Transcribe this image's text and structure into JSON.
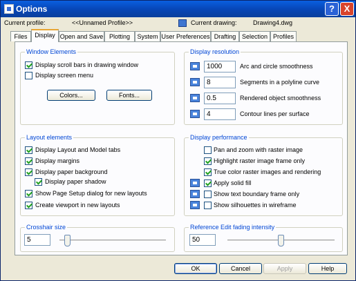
{
  "window": {
    "title": "Options"
  },
  "titlebar_buttons": {
    "help": "?",
    "close": "X"
  },
  "profile": {
    "current_profile_label": "Current profile:",
    "current_profile_value": "<<Unnamed Profile>>",
    "current_drawing_label": "Current drawing:",
    "current_drawing_value": "Drawing4.dwg"
  },
  "tabs": [
    "Files",
    "Display",
    "Open and Save",
    "Plotting",
    "System",
    "User Preferences",
    "Drafting",
    "Selection",
    "Profiles"
  ],
  "active_tab": "Display",
  "window_elements": {
    "title": "Window Elements",
    "scroll_bars": {
      "label": "Display scroll bars in drawing window",
      "checked": true
    },
    "screen_menu": {
      "label": "Display screen menu",
      "checked": false
    },
    "colors_button": "Colors...",
    "fonts_button": "Fonts..."
  },
  "display_resolution": {
    "title": "Display resolution",
    "rows": [
      {
        "value": "1000",
        "label": "Arc and circle smoothness"
      },
      {
        "value": "8",
        "label": "Segments in a polyline curve"
      },
      {
        "value": "0.5",
        "label": "Rendered object smoothness"
      },
      {
        "value": "4",
        "label": "Contour lines per surface"
      }
    ]
  },
  "layout_elements": {
    "title": "Layout elements",
    "items": [
      {
        "label": "Display Layout and Model tabs",
        "checked": true
      },
      {
        "label": "Display margins",
        "checked": true
      },
      {
        "label": "Display paper background",
        "checked": true
      },
      {
        "label": "Display paper shadow",
        "checked": true
      },
      {
        "label": "Show Page Setup dialog for new layouts",
        "checked": true
      },
      {
        "label": "Create viewport in new layouts",
        "checked": true
      }
    ]
  },
  "display_performance": {
    "title": "Display performance",
    "items": [
      {
        "label": "Pan and zoom with raster image",
        "checked": false
      },
      {
        "label": "Highlight raster image frame only",
        "checked": true
      },
      {
        "label": "True color raster images and rendering",
        "checked": true
      },
      {
        "label": "Apply solid fill",
        "checked": true
      },
      {
        "label": "Show text boundary frame only",
        "checked": false
      },
      {
        "label": "Show silhouettes in wireframe",
        "checked": false
      }
    ]
  },
  "crosshair": {
    "title": "Crosshair size",
    "value": "5",
    "level_percent": 5
  },
  "xref_fading": {
    "title": "Reference Edit fading intensity",
    "value": "50",
    "level_percent": 50
  },
  "footer": {
    "ok": "OK",
    "cancel": "Cancel",
    "apply": "Apply",
    "help": "Help"
  }
}
